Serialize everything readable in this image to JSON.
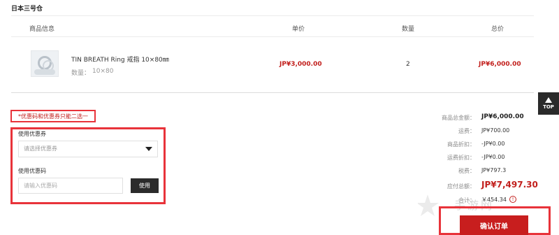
{
  "warehouse": {
    "title": "日本三号仓"
  },
  "table": {
    "headers": {
      "info": "商品信息",
      "unit_price": "单价",
      "quantity": "数量",
      "total": "总价"
    },
    "items": [
      {
        "name": "TIN BREATH Ring 戒指 10×80㎜",
        "spec_label": "数量：",
        "spec_value": "10×80",
        "unit_price": "JP¥3,000.00",
        "quantity": "2",
        "total": "JP¥6,000.00"
      }
    ]
  },
  "coupon": {
    "note": "*优惠码和优惠券只能二选一",
    "coupon_label": "使用优惠券",
    "coupon_select_placeholder": "请选择优惠券",
    "code_label": "使用优惠码",
    "code_placeholder": "请输入优惠码",
    "use_button": "使用"
  },
  "summary": {
    "rows": [
      {
        "label": "商品总金额：",
        "value": "JP¥6,000.00"
      },
      {
        "label": "运费：",
        "value": "JP¥700.00"
      },
      {
        "label": "商品折扣：",
        "value": "-JP¥0.00"
      },
      {
        "label": "运费折扣：",
        "value": "-JP¥0.00"
      },
      {
        "label": "税费：",
        "value": "JP¥797.3"
      }
    ],
    "pay_label": "应付总额：",
    "pay_value": "JP¥7,497.30",
    "yen_label": "合计：",
    "yen_value": "￥454.34",
    "info_icon": "!"
  },
  "top_button": {
    "label": "TOP"
  },
  "confirm": {
    "label": "确认订单"
  },
  "watermark": {
    "text": "手游网"
  },
  "colors": {
    "accent": "#c2201d",
    "highlight_box": "#e8333a",
    "dark_button": "#2b2b2b"
  }
}
